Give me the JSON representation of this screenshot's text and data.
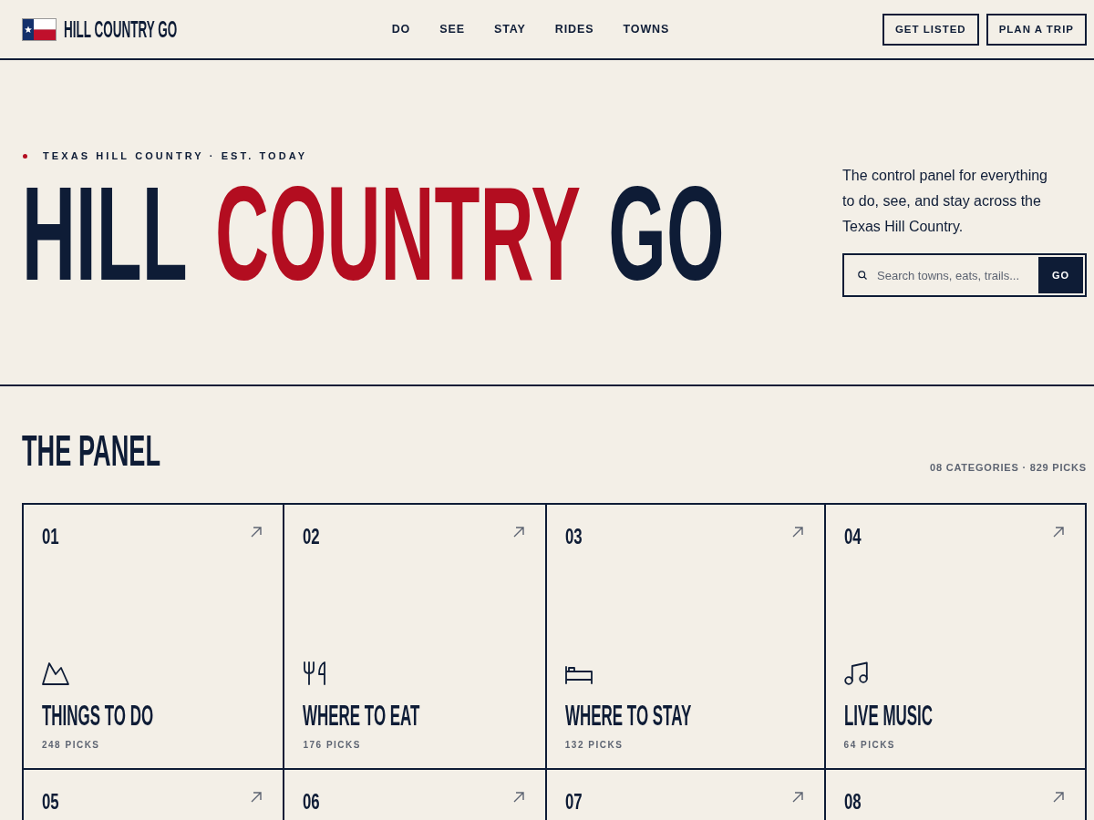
{
  "header": {
    "logo": "HILL COUNTRY GO",
    "nav": [
      "DO",
      "SEE",
      "STAY",
      "RIDES",
      "TOWNS"
    ],
    "buttons": [
      "GET LISTED",
      "PLAN A TRIP"
    ]
  },
  "hero": {
    "eyebrow": "TEXAS HILL COUNTRY · EST. TODAY",
    "title_parts": [
      {
        "text": "HILL",
        "accent": false
      },
      {
        "text": "COUNTRY",
        "accent": true
      },
      {
        "text": "GO",
        "accent": false
      }
    ],
    "description": "The control panel for everything to do, see, and stay across the Texas Hill Country.",
    "search": {
      "placeholder": "Search towns, eats, trails...",
      "button": "GO"
    }
  },
  "panel": {
    "title": "THE PANEL",
    "meta": "08 CATEGORIES · 829 PICKS",
    "cards": [
      {
        "number": "01",
        "title": "THINGS TO DO",
        "picks": "248 PICKS"
      },
      {
        "number": "02",
        "title": "WHERE TO EAT",
        "picks": "176 PICKS"
      },
      {
        "number": "03",
        "title": "WHERE TO STAY",
        "picks": "132 PICKS"
      },
      {
        "number": "04",
        "title": "LIVE MUSIC",
        "picks": "64 PICKS"
      },
      {
        "number": "05"
      },
      {
        "number": "06"
      },
      {
        "number": "07"
      },
      {
        "number": "08"
      }
    ]
  }
}
